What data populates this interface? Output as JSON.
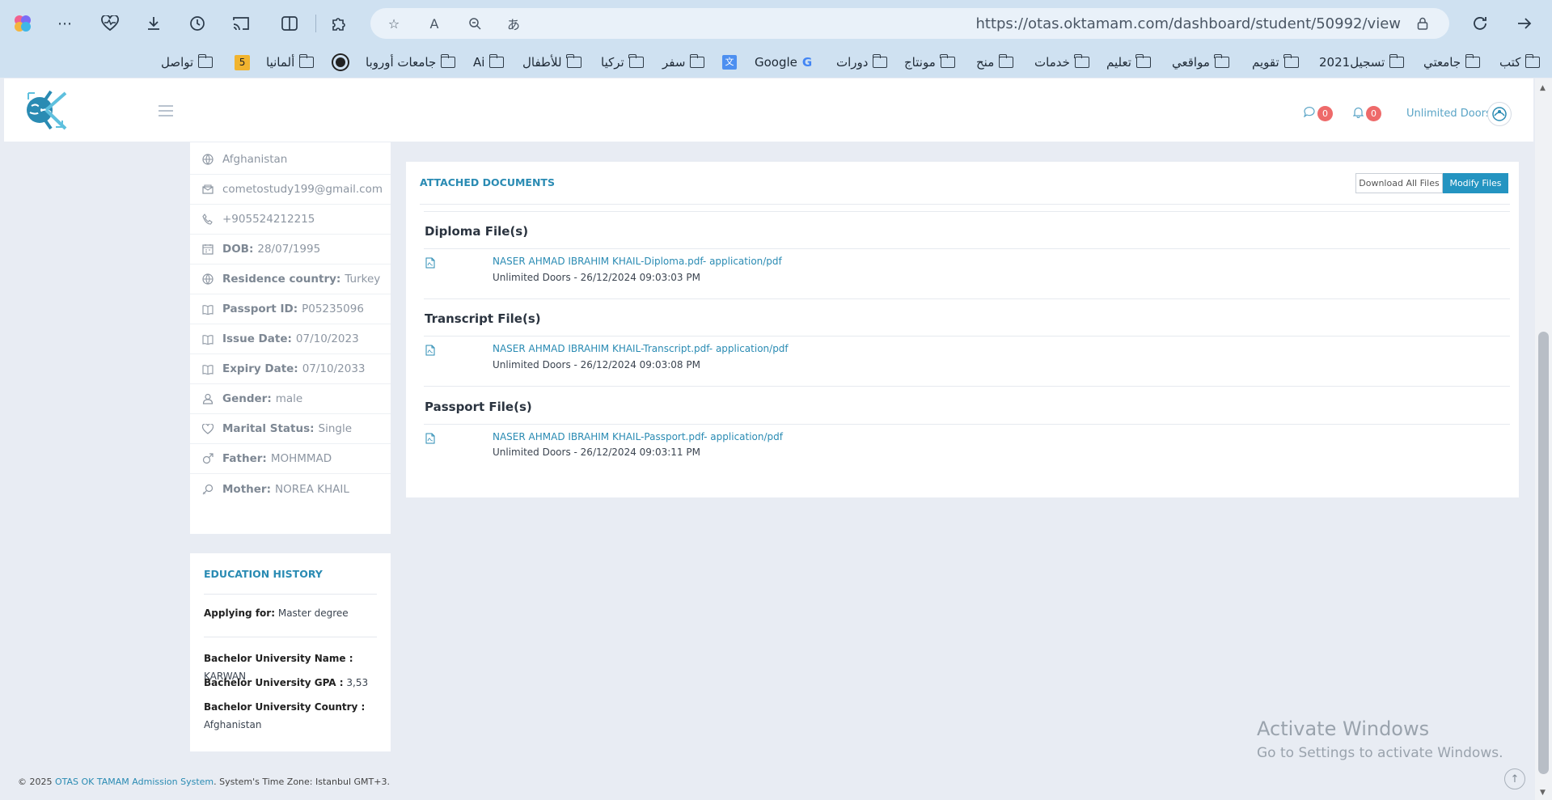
{
  "browser": {
    "url": "https://otas.oktamam.com/dashboard/student/50992/view",
    "bookmarks": [
      {
        "label": "كتب"
      },
      {
        "label": "جامعتي"
      },
      {
        "label": "تسجيل2021"
      },
      {
        "label": "تقويم"
      },
      {
        "label": "مواقعي"
      },
      {
        "label": "تعليم"
      },
      {
        "label": "خدمات"
      },
      {
        "label": "منح"
      },
      {
        "label": "مونتاج"
      },
      {
        "label": "دورات"
      },
      {
        "label": "Google"
      },
      {
        "label": "سفر"
      },
      {
        "label": "تركيا"
      },
      {
        "label": "للأطفال"
      },
      {
        "label": "Ai"
      },
      {
        "label": "جامعات أوروبا"
      },
      {
        "label": "ألمانيا"
      },
      {
        "label": "5"
      },
      {
        "label": "تواصل"
      }
    ]
  },
  "header": {
    "messages_count": "0",
    "notifications_count": "0",
    "user_name": "Unlimited Doors"
  },
  "profile": {
    "country": "Afghanistan",
    "email": "cometostudy199@gmail.com",
    "phone": "+905524212215",
    "dob_label": "DOB:",
    "dob": "28/07/1995",
    "residence_label": "Residence country:",
    "residence": "Turkey",
    "passport_label": "Passport ID:",
    "passport": "P05235096",
    "issue_label": "Issue Date:",
    "issue": "07/10/2023",
    "expiry_label": "Expiry Date:",
    "expiry": "07/10/2033",
    "gender_label": "Gender:",
    "gender": "male",
    "marital_label": "Marital Status:",
    "marital": "Single",
    "father_label": "Father:",
    "father": "MOHMMAD",
    "mother_label": "Mother:",
    "mother": "NOREA KHAIL"
  },
  "education": {
    "title": "EDUCATION HISTORY",
    "applying_label": "Applying for:",
    "applying": "Master degree",
    "bach_name_label": "Bachelor University Name :",
    "bach_name": "KARWAN",
    "bach_gpa_label": "Bachelor University GPA :",
    "bach_gpa": "3,53",
    "bach_country_label": "Bachelor University Country :",
    "bach_country": "Afghanistan"
  },
  "documents": {
    "title": "ATTACHED DOCUMENTS",
    "download_all": "Download All Files",
    "modify": "Modify Files",
    "sections": [
      {
        "title": "Diploma File(s)",
        "file": "NASER AHMAD IBRAHIM KHAIL-Diploma.pdf- application/pdf",
        "meta": "Unlimited Doors - 26/12/2024 09:03:03 PM"
      },
      {
        "title": "Transcript File(s)",
        "file": "NASER AHMAD IBRAHIM KHAIL-Transcript.pdf- application/pdf",
        "meta": "Unlimited Doors - 26/12/2024 09:03:08 PM"
      },
      {
        "title": "Passport File(s)",
        "file": "NASER AHMAD IBRAHIM KHAIL-Passport.pdf- application/pdf",
        "meta": "Unlimited Doors - 26/12/2024 09:03:11 PM"
      }
    ]
  },
  "footer": {
    "prefix": "© 2025",
    "link": "OTAS OK TAMAM Admission System",
    "suffix": ". System's Time Zone: Istanbul GMT+3."
  },
  "watermark": {
    "line1": "Activate Windows",
    "line2": "Go to Settings to activate Windows."
  }
}
